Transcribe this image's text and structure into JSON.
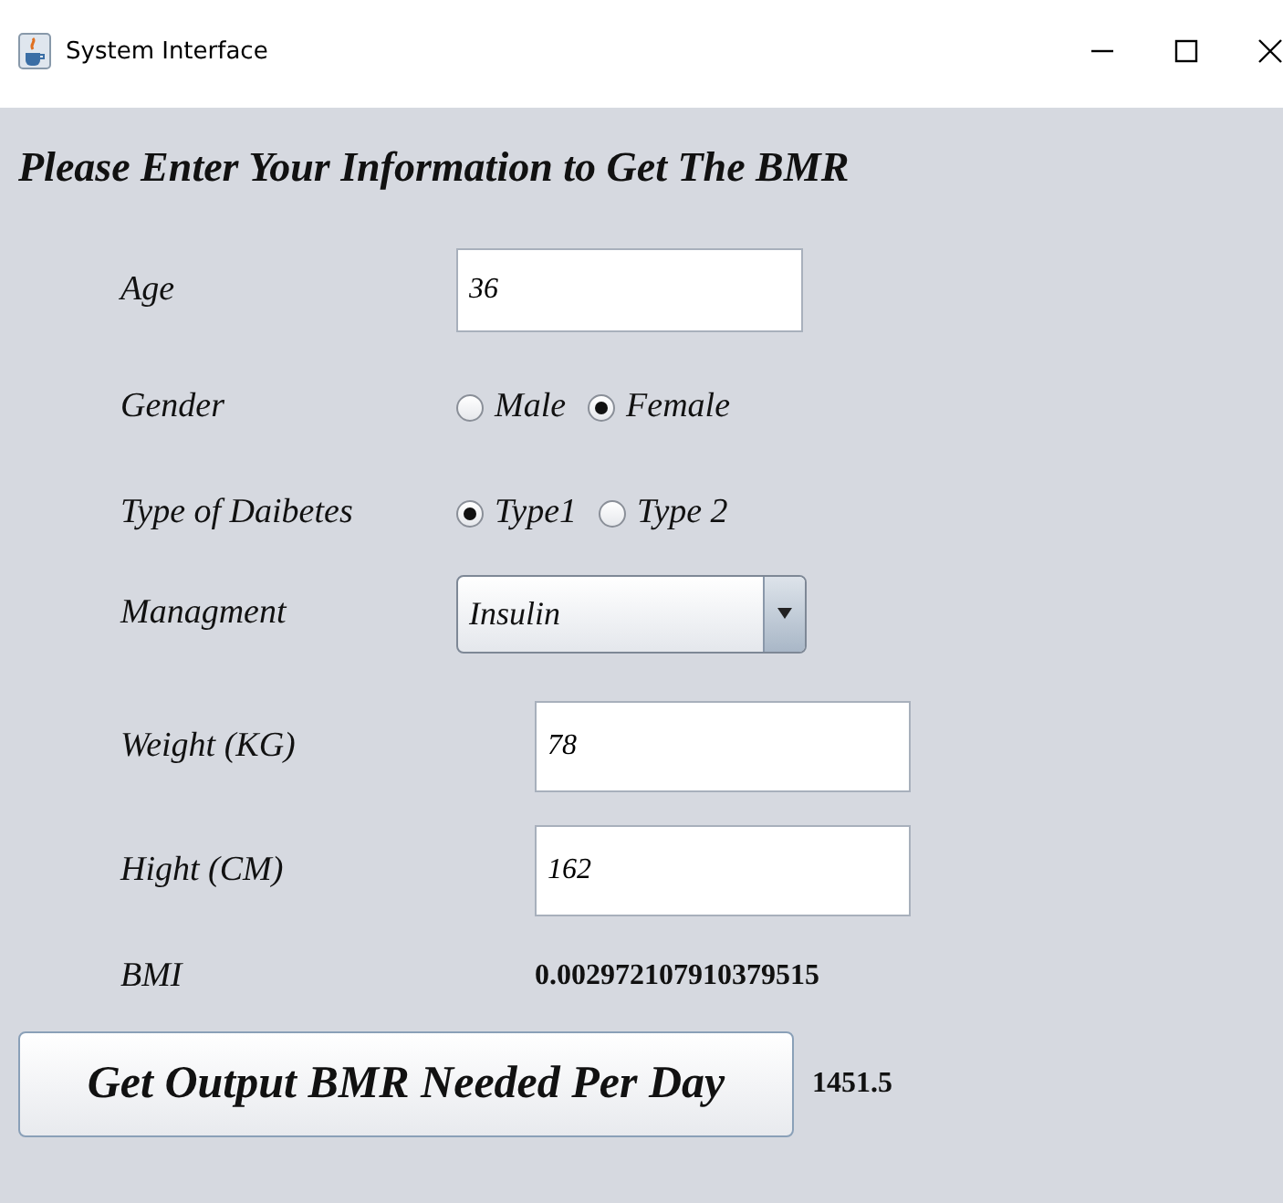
{
  "window": {
    "title": "System Interface"
  },
  "heading": "Please Enter Your Information to Get The BMR",
  "rows": [
    {
      "kind": "text",
      "label": "Age",
      "value": "36",
      "wide": false
    },
    {
      "kind": "radio",
      "label": "Gender",
      "options": [
        {
          "label": "Male",
          "selected": false
        },
        {
          "label": "Female",
          "selected": true
        }
      ]
    },
    {
      "kind": "radio",
      "label": "Type of Daibetes",
      "options": [
        {
          "label": "Type1",
          "selected": true
        },
        {
          "label": "Type 2",
          "selected": false
        }
      ]
    },
    {
      "kind": "select",
      "label": "Managment",
      "value": "Insulin"
    },
    {
      "kind": "text",
      "label": "Weight (KG)",
      "value": "78",
      "wide": true
    },
    {
      "kind": "text",
      "label": "Hight (CM)",
      "value": "162",
      "wide": true
    },
    {
      "kind": "output",
      "label": "BMI",
      "value": "0.002972107910379515"
    }
  ],
  "action": {
    "label": "Get Output BMR Needed Per Day",
    "result": "1451.5"
  }
}
